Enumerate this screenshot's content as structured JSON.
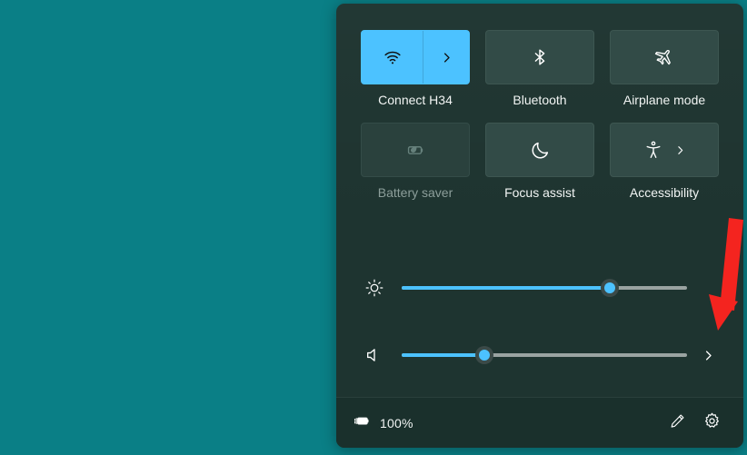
{
  "desktop": {
    "background_color": "#0a7f86"
  },
  "panel": {
    "name": "quick-settings",
    "background_color": "#1e3430",
    "accent_color": "#4cc2ff",
    "tiles": [
      {
        "id": "wifi",
        "label": "Connect H34",
        "icon": "wifi-icon",
        "state": "on",
        "has_chevron": true,
        "chevron_style": "split",
        "chevron_icon": "chevron-right-icon"
      },
      {
        "id": "bluetooth",
        "label": "Bluetooth",
        "icon": "bluetooth-icon",
        "state": "off",
        "has_chevron": false
      },
      {
        "id": "airplane-mode",
        "label": "Airplane mode",
        "icon": "airplane-icon",
        "state": "off",
        "has_chevron": false
      },
      {
        "id": "battery-saver",
        "label": "Battery saver",
        "icon": "battery-saver-icon",
        "state": "disabled",
        "has_chevron": false
      },
      {
        "id": "focus-assist",
        "label": "Focus assist",
        "icon": "moon-icon",
        "state": "off",
        "has_chevron": false
      },
      {
        "id": "accessibility",
        "label": "Accessibility",
        "icon": "accessibility-person-icon",
        "state": "off",
        "has_chevron": true,
        "chevron_style": "inline",
        "chevron_icon": "chevron-right-icon"
      }
    ],
    "sliders": [
      {
        "id": "brightness",
        "icon": "brightness-sun-icon",
        "value": 73,
        "min": 0,
        "max": 100,
        "has_chevron": false
      },
      {
        "id": "volume",
        "icon": "volume-speaker-icon",
        "value": 29,
        "min": 0,
        "max": 100,
        "has_chevron": true,
        "chevron_icon": "chevron-right-icon"
      }
    ],
    "footer": {
      "battery_icon": "battery-charging-icon",
      "battery_percent": "100%",
      "edit_icon": "pencil-edit-icon",
      "settings_icon": "gear-settings-icon"
    }
  },
  "annotation": {
    "type": "arrow",
    "color": "#f4241f",
    "direction": "down",
    "points_to": "volume-expand-chevron"
  }
}
